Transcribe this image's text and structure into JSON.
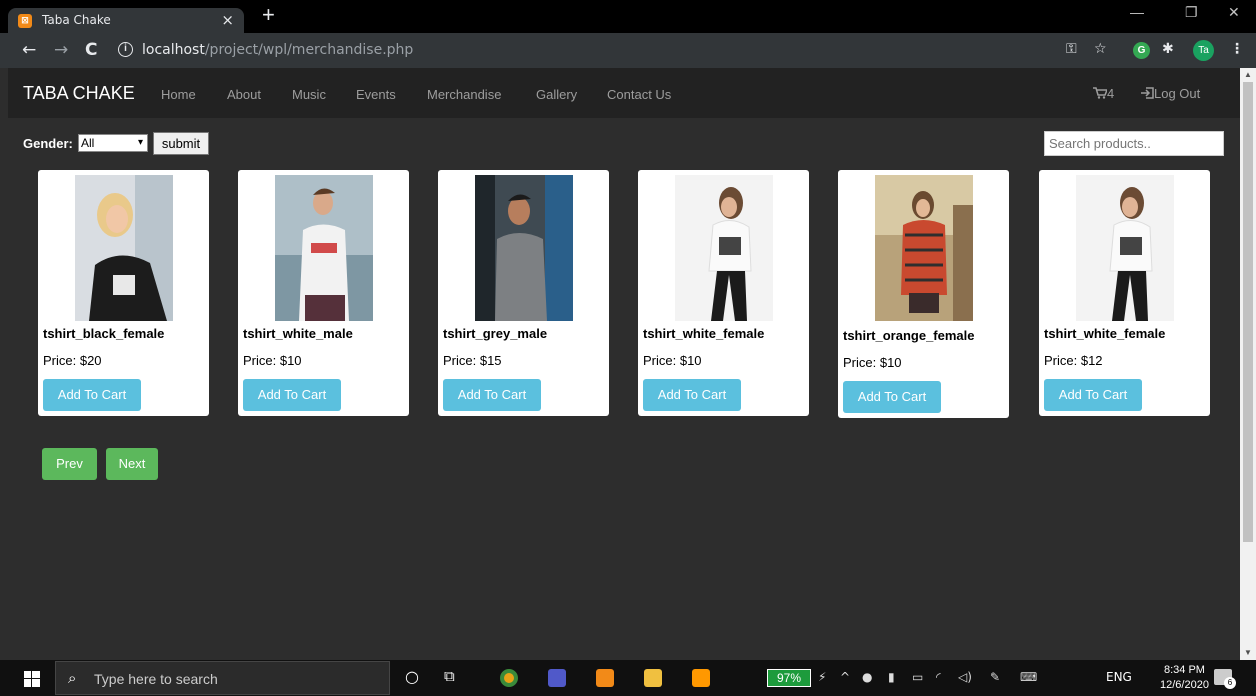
{
  "browser": {
    "tab_title": "Taba Chake",
    "tab_close": "×",
    "new_tab": "+",
    "url_host": "localhost",
    "url_path": "/project/wpl/merchandise.php",
    "back_icon": "←",
    "forward_icon": "→",
    "reload_icon": "C",
    "info_icon": "i"
  },
  "navbar": {
    "brand": "TABA CHAKE",
    "links": [
      "Home",
      "About",
      "Music",
      "Events",
      "Merchandise",
      "Gallery",
      "Contact Us"
    ],
    "cart_count": "4",
    "logout": "Log Out"
  },
  "filter": {
    "gender_label": "Gender:",
    "gender_selected": "All",
    "submit": "submit",
    "search_placeholder": "Search products.."
  },
  "products": [
    {
      "name": "tshirt_black_female",
      "price": "Price: $20",
      "button": "Add To Cart"
    },
    {
      "name": "tshirt_white_male",
      "price": "Price: $10",
      "button": "Add To Cart"
    },
    {
      "name": "tshirt_grey_male",
      "price": "Price: $15",
      "button": "Add To Cart"
    },
    {
      "name": "tshirt_white_female",
      "price": "Price: $10",
      "button": "Add To Cart"
    },
    {
      "name": "tshirt_orange_female",
      "price": "Price: $10",
      "button": "Add To Cart"
    },
    {
      "name": "tshirt_white_female",
      "price": "Price: $12",
      "button": "Add To Cart"
    }
  ],
  "pagination": {
    "prev": "Prev",
    "next": "Next"
  },
  "taskbar": {
    "search_placeholder": "Type here to search",
    "battery": "97%",
    "language": "ENG",
    "time": "8:34 PM",
    "date": "12/6/2020",
    "notifications": "6"
  },
  "colors": {
    "navbar_bg": "#222222",
    "page_bg": "#2d2d2d",
    "add_button": "#5bc0de",
    "pager_button": "#5cb85c"
  }
}
